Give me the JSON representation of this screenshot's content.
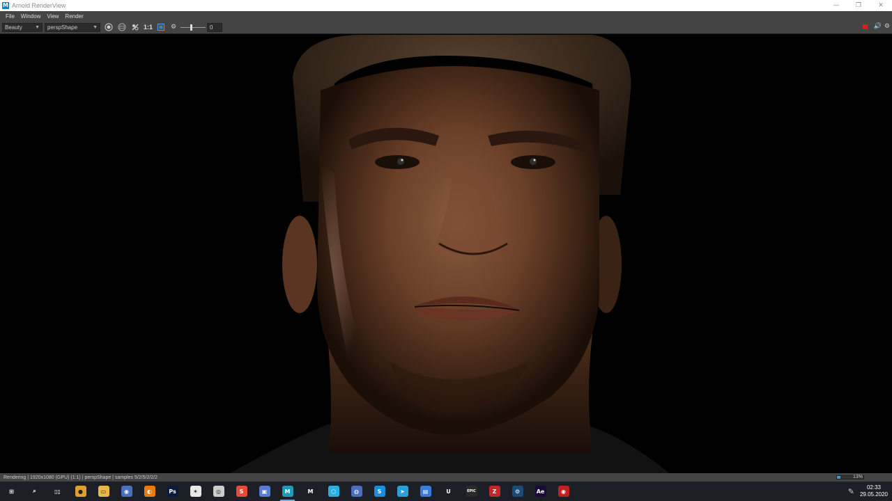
{
  "window": {
    "title": "Arnold RenderView",
    "app_icon": "maya-m-icon",
    "controls": {
      "minimize": "—",
      "restore": "❐",
      "close": "✕"
    }
  },
  "menubar": {
    "items": [
      "File",
      "Window",
      "View",
      "Render"
    ]
  },
  "toolbar": {
    "aov_dropdown": "Beauty",
    "camera_dropdown": "perspShape",
    "ratio_label": "1:1",
    "exposure_value": "0",
    "icons": [
      "render-region-icon",
      "crop-region-icon",
      "compare-icon",
      "ratio-text",
      "frame-icon",
      "gear-icon"
    ],
    "right_icons": [
      "stop-render-icon",
      "speaker-icon",
      "settings-icon"
    ]
  },
  "render": {
    "description_free": true
  },
  "statusbar": {
    "text": "Rendering | 1920x1080 (GPU) (1:1) | perspShape | samples 5/2/5/2/2/2",
    "progress_percent": 13,
    "progress_label": "13%"
  },
  "taskbar": {
    "apps": [
      {
        "name": "windows-start",
        "glyph": "⊞",
        "color": "#1c1f25"
      },
      {
        "name": "search",
        "glyph": "⌕",
        "color": "#1c1f25"
      },
      {
        "name": "task-view",
        "glyph": "▯▯",
        "color": "#1c1f25"
      },
      {
        "name": "chrome",
        "glyph": "●",
        "color": "#e0a030"
      },
      {
        "name": "file-explorer",
        "glyph": "▭",
        "color": "#e8b84a"
      },
      {
        "name": "app-circle",
        "glyph": "◉",
        "color": "#4a6fbf"
      },
      {
        "name": "blender",
        "glyph": "◐",
        "color": "#e87d0d"
      },
      {
        "name": "photoshop",
        "glyph": "Ps",
        "color": "#0a1a3a"
      },
      {
        "name": "inkscape",
        "glyph": "✶",
        "color": "#e8e8e8"
      },
      {
        "name": "camera-app",
        "glyph": "◎",
        "color": "#cccccc"
      },
      {
        "name": "substance",
        "glyph": "S",
        "color": "#e84a3a"
      },
      {
        "name": "save-app",
        "glyph": "▣",
        "color": "#5a7ad8"
      },
      {
        "name": "maya",
        "glyph": "M",
        "color": "#1f9bb8",
        "active": true
      },
      {
        "name": "mari",
        "glyph": "M",
        "color": "#1c1f25"
      },
      {
        "name": "app-cyan",
        "glyph": "⬡",
        "color": "#2ab0e0"
      },
      {
        "name": "discord",
        "glyph": "◍",
        "color": "#4a6fbf"
      },
      {
        "name": "skype",
        "glyph": "S",
        "color": "#1a8fe0"
      },
      {
        "name": "telegram",
        "glyph": "➤",
        "color": "#2aa0d8"
      },
      {
        "name": "monitor-app",
        "glyph": "▤",
        "color": "#3a7ad8"
      },
      {
        "name": "unreal",
        "glyph": "U",
        "color": "#1c1f25"
      },
      {
        "name": "epic",
        "glyph": "EPIC",
        "color": "#2a2a2a"
      },
      {
        "name": "filezilla",
        "glyph": "Z",
        "color": "#c0282a"
      },
      {
        "name": "steam",
        "glyph": "⚙",
        "color": "#1a4a7a"
      },
      {
        "name": "after-effects",
        "glyph": "Ae",
        "color": "#1a0a3a"
      },
      {
        "name": "obs",
        "glyph": "◉",
        "color": "#c02020"
      }
    ],
    "clock": {
      "time": "02:33",
      "date": "29.05.2020"
    }
  }
}
